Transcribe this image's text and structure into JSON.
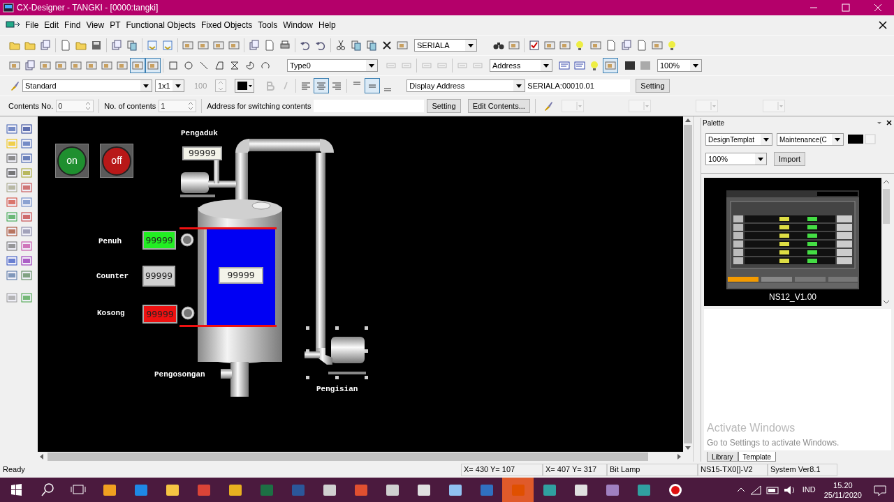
{
  "window": {
    "title": "CX-Designer - TANGKI - [0000:tangki]"
  },
  "menu": [
    {
      "label": "File"
    },
    {
      "label": "Edit"
    },
    {
      "label": "Find"
    },
    {
      "label": "View"
    },
    {
      "label": "PT"
    },
    {
      "label": "Functional Objects"
    },
    {
      "label": "Fixed Objects"
    },
    {
      "label": "Tools"
    },
    {
      "label": "Window"
    },
    {
      "label": "Help"
    }
  ],
  "toolbar_1": {
    "device_select": "SERIALA"
  },
  "toolbar_2": {
    "type_select": "Type0",
    "address_select": "Address",
    "zoom_select": "100%"
  },
  "toolbar_3": {
    "style_select": "Standard",
    "size_select": "1x1",
    "size_value": "100",
    "display_select": "Display Address",
    "address_value": "SERIALA:00010.01",
    "setting_button": "Setting"
  },
  "toolbar_4": {
    "contents_no_label": "Contents No.",
    "contents_no": "0",
    "no_of_contents_label": "No. of contents",
    "no_of_contents": "1",
    "address_label": "Address for switching contents",
    "setting_button": "Setting",
    "edit_button": "Edit Contents..."
  },
  "canvas": {
    "buttons": [
      {
        "label": "on",
        "color": "#1f8f2f"
      },
      {
        "label": "off",
        "color": "#b81818"
      }
    ],
    "labels": [
      "Pengaduk",
      "Penuh",
      "Counter",
      "Kosong",
      "Pengosongan",
      "Pengisian"
    ],
    "displays": [
      {
        "value": "99999",
        "color": "#f4f4ea"
      },
      {
        "value": "99999",
        "color": "#22ee22"
      },
      {
        "value": "99999",
        "color": "#d0d0d0"
      },
      {
        "value": "99999",
        "color": "#ee1111"
      },
      {
        "value": "99999",
        "color": "#f4f4ea"
      }
    ]
  },
  "palette": {
    "title": "Palette",
    "template_select": "DesignTemplat",
    "category_select": "Maintenance(C",
    "zoom_select": "100%",
    "import_button": "Import",
    "template_caption": "NS12_V1.00",
    "activate_title": "Activate Windows",
    "activate_text": "Go to Settings to activate Windows.",
    "tabs": [
      {
        "label": "Library",
        "selected": false
      },
      {
        "label": "Template",
        "selected": true
      }
    ]
  },
  "status_bar": [
    "Ready",
    "X= 430 Y= 107",
    "X= 407 Y= 317",
    "Bit Lamp",
    "NS15-TX0[]-V2",
    "System Ver8.1"
  ],
  "taskbar": {
    "language": "IND",
    "time": "15.20",
    "date": "25/11/2020"
  }
}
